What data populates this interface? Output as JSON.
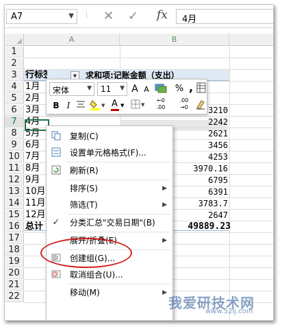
{
  "formula_bar": {
    "name_box": "A7",
    "cancel_glyph": "✕",
    "enter_glyph": "✓",
    "fx_label": "fx",
    "formula_value": "4月"
  },
  "columns": [
    {
      "label": "A"
    },
    {
      "label": "B"
    }
  ],
  "rows": [
    {
      "num": "1",
      "a": "",
      "b": ""
    },
    {
      "num": "2",
      "a": "",
      "b": ""
    },
    {
      "num": "3",
      "a": "行标签",
      "b": "求和项:记账金额（支出）"
    },
    {
      "num": "4",
      "a": "1月",
      "b": ""
    },
    {
      "num": "5",
      "a": "2月",
      "b": ""
    },
    {
      "num": "6",
      "a": "3月",
      "b": "3210"
    },
    {
      "num": "7",
      "a": "4月",
      "b": "2242"
    },
    {
      "num": "8",
      "a": "5月",
      "b": "2621"
    },
    {
      "num": "9",
      "a": "6月",
      "b": "3456"
    },
    {
      "num": "10",
      "a": "7月",
      "b": "4253"
    },
    {
      "num": "11",
      "a": "8月",
      "b": "3970.16"
    },
    {
      "num": "12",
      "a": "9月",
      "b": "6795"
    },
    {
      "num": "13",
      "a": "10月",
      "b": "6391"
    },
    {
      "num": "14",
      "a": "11月",
      "b": "3783.7"
    },
    {
      "num": "15",
      "a": "12月",
      "b": "2647"
    },
    {
      "num": "16",
      "a": "总计",
      "b": "49889.23"
    },
    {
      "num": "17",
      "a": "",
      "b": ""
    },
    {
      "num": "18",
      "a": "",
      "b": ""
    },
    {
      "num": "19",
      "a": "",
      "b": ""
    },
    {
      "num": "20",
      "a": "",
      "b": ""
    },
    {
      "num": "21",
      "a": "",
      "b": ""
    },
    {
      "num": "22",
      "a": "",
      "b": ""
    }
  ],
  "mini_toolbar": {
    "font_name": "宋体",
    "font_size": "11",
    "grow_font": "A",
    "shrink_font": "A",
    "percent": "%",
    "comma": ",",
    "bold": "B",
    "italic": "I",
    "font_color_letter": "A",
    "increase_decimal": ".00",
    "decrease_decimal": ".00",
    "accent_color": "#c00000"
  },
  "context_menu": {
    "items": [
      {
        "label": "复制(C)",
        "icon": "copy-icon",
        "has_submenu": false
      },
      {
        "label": "设置单元格格式(F)...",
        "icon": "format-cells-icon",
        "has_submenu": false
      },
      {
        "label": "刷新(R)",
        "icon": "refresh-icon",
        "has_submenu": false
      },
      {
        "label": "排序(S)",
        "icon": "",
        "has_submenu": true
      },
      {
        "label": "筛选(T)",
        "icon": "",
        "has_submenu": true
      },
      {
        "label": "分类汇总\"交易日期\"(B)",
        "icon": "check-icon",
        "has_submenu": false
      },
      {
        "label": "展开/折叠(E)",
        "icon": "",
        "has_submenu": true
      },
      {
        "label": "创建组(G)...",
        "icon": "group-icon",
        "has_submenu": false
      },
      {
        "label": "取消组合(U)...",
        "icon": "ungroup-icon",
        "has_submenu": false
      },
      {
        "label": "移动(M)",
        "icon": "",
        "has_submenu": true
      }
    ],
    "highlight_color": "#d21f1f"
  },
  "watermark": {
    "text": "我爱研技术网",
    "url": "www.52ij.com"
  }
}
